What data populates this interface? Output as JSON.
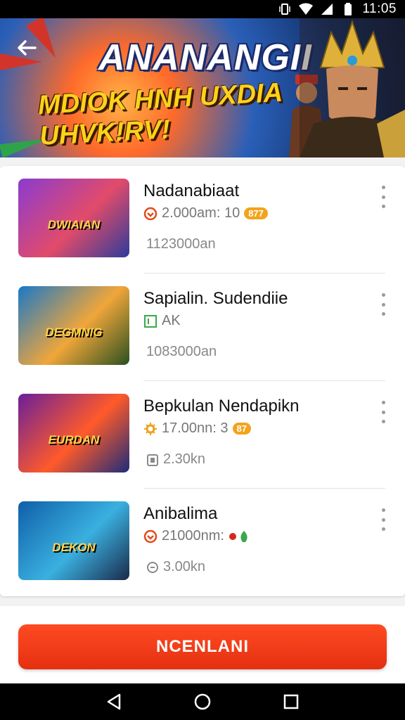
{
  "status_bar": {
    "time": "11:05"
  },
  "banner": {
    "title": "ANANANGII",
    "subtitle": "MDIOK HNH UXDIA UHVK!RV!"
  },
  "games": [
    {
      "name": "Nadanabiaat",
      "meta": "2.000am: 10",
      "badge": "877",
      "size": "1123000an",
      "thumb_label": "DWIAIAN",
      "colors": [
        "#8a3bd1",
        "#e24b6a",
        "#2c3c9a"
      ]
    },
    {
      "name": "Sapialin. Sudendiie",
      "meta": "AK",
      "badge": "",
      "size": "1083000an",
      "thumb_label": "DEGMNIG",
      "colors": [
        "#1a78c8",
        "#f0a63a",
        "#2a5020"
      ]
    },
    {
      "name": "Bepkulan Nendapikn",
      "meta": "17.00nn: 3",
      "badge": "87",
      "size": "2.30kn",
      "thumb_label": "EURDAN",
      "colors": [
        "#6a1f9a",
        "#ff5a2a",
        "#1c2c7a"
      ]
    },
    {
      "name": "Anibalima",
      "meta": "21000nm:",
      "badge": "",
      "size": "3.00kn",
      "thumb_label": "DEKON",
      "colors": [
        "#0f5fa8",
        "#3ab0e0",
        "#1a2a4a"
      ]
    }
  ],
  "cta": {
    "label": "NCENLANI"
  },
  "colors": {
    "accent": "#e4300f",
    "badge": "#f4a31b"
  }
}
